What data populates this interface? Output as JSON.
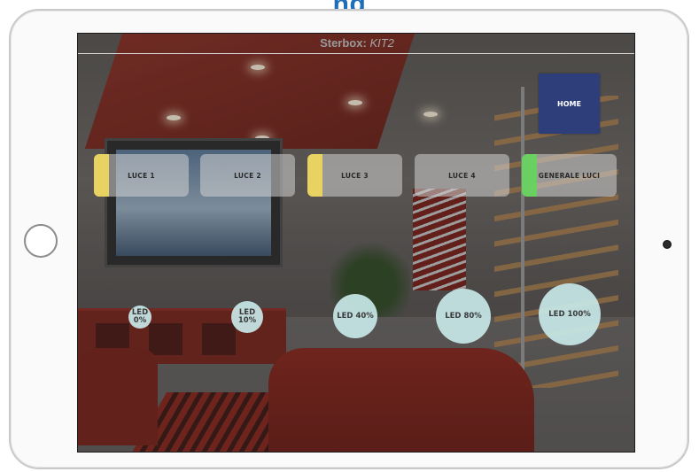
{
  "page": {
    "heading": "ng"
  },
  "app": {
    "title_prefix": "Sterbox:",
    "title_device": "KIT2"
  },
  "nav": {
    "home_label": "HOME"
  },
  "light_buttons": [
    {
      "label": "LUCE 1",
      "indicator_color": "#e8d261"
    },
    {
      "label": "LUCE 2",
      "indicator_color": ""
    },
    {
      "label": "LUCE 3",
      "indicator_color": "#e8d261"
    },
    {
      "label": "LUCE 4",
      "indicator_color": ""
    },
    {
      "label": "GENERALE LUCI",
      "indicator_color": "#6ad061"
    }
  ],
  "led_buttons": [
    {
      "label": "LED 0%"
    },
    {
      "label": "LED 10%"
    },
    {
      "label": "LED 40%"
    },
    {
      "label": "LED 80%"
    },
    {
      "label": "LED 100%"
    }
  ],
  "colors": {
    "home_button": "#2e3e7a",
    "led_button": "#c8e8e8",
    "heading": "#1f6fb8"
  }
}
